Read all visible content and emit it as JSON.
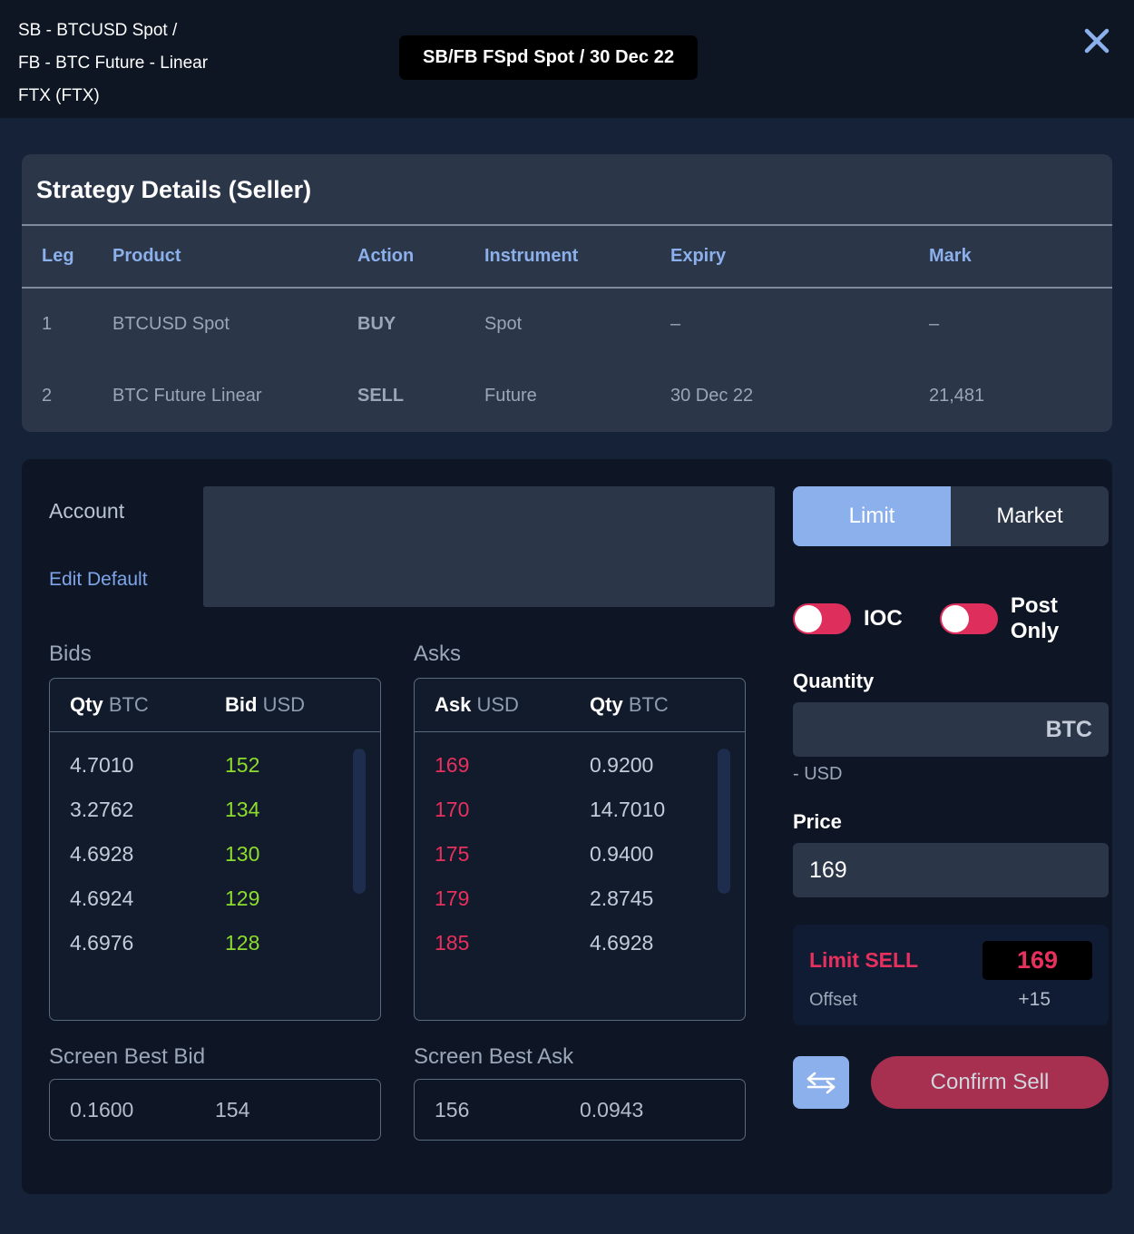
{
  "header": {
    "title_lines": "SB - BTCUSD Spot /\nFB - BTC Future - Linear\nFTX (FTX)",
    "badge": "SB/FB FSpd Spot / 30 Dec 22",
    "close_icon": "close-icon"
  },
  "strategy": {
    "title": "Strategy Details (Seller)",
    "columns": [
      "Leg",
      "Product",
      "Action",
      "Instrument",
      "Expiry",
      "Mark"
    ],
    "rows": [
      {
        "leg": "1",
        "product": "BTCUSD Spot",
        "action": "BUY",
        "action_type": "buy",
        "instrument": "Spot",
        "expiry": "–",
        "mark": "–"
      },
      {
        "leg": "2",
        "product": "BTC Future Linear",
        "action": "SELL",
        "action_type": "sell",
        "instrument": "Future",
        "expiry": "30 Dec 22",
        "mark": "21,481"
      }
    ]
  },
  "order_form": {
    "account_label": "Account",
    "edit_default_label": "Edit Default",
    "account_value": "",
    "order_type": {
      "limit_label": "Limit",
      "market_label": "Market",
      "selected": "Limit"
    },
    "toggles": [
      {
        "name": "ioc",
        "label": "IOC",
        "on": false
      },
      {
        "name": "post-only",
        "label": "Post Only",
        "on": false
      }
    ],
    "quantity": {
      "label": "Quantity",
      "value": "",
      "unit": "BTC",
      "note": "- USD"
    },
    "price": {
      "label": "Price",
      "value": "169"
    },
    "summary": {
      "side_label": "Limit SELL",
      "price": "169",
      "offset_label": "Offset",
      "offset_value": "+15"
    },
    "swap_icon": "swap-horizontal-icon",
    "confirm_label": "Confirm Sell"
  },
  "bids": {
    "label": "Bids",
    "col_qty": "Qty",
    "col_qty_unit": "BTC",
    "col_price": "Bid",
    "col_price_unit": "USD",
    "rows": [
      {
        "qty": "4.7010",
        "price": "152"
      },
      {
        "qty": "3.2762",
        "price": "134"
      },
      {
        "qty": "4.6928",
        "price": "130"
      },
      {
        "qty": "4.6924",
        "price": "129"
      },
      {
        "qty": "4.6976",
        "price": "128"
      }
    ]
  },
  "asks": {
    "label": "Asks",
    "col_price": "Ask",
    "col_price_unit": "USD",
    "col_qty": "Qty",
    "col_qty_unit": "BTC",
    "rows": [
      {
        "price": "169",
        "qty": "0.9200"
      },
      {
        "price": "170",
        "qty": "14.7010"
      },
      {
        "price": "175",
        "qty": "0.9400"
      },
      {
        "price": "179",
        "qty": "2.8745"
      },
      {
        "price": "185",
        "qty": "4.6928"
      }
    ]
  },
  "screen_best_bid": {
    "label": "Screen Best Bid",
    "qty": "0.1600",
    "price": "154"
  },
  "screen_best_ask": {
    "label": "Screen Best Ask",
    "price": "156",
    "qty": "0.0943"
  },
  "colors": {
    "page_bg": "#152238",
    "topbar_bg": "#0e1623",
    "strategy_card_bg": "#2b3648",
    "main_panel_bg": "#0e1626",
    "accent_blue": "#8cb0ec",
    "buy_green": "#9ade2c",
    "sell_red": "#e8305e",
    "toggle_red": "#dd2e5c",
    "confirm_bg": "#a72f4f"
  }
}
